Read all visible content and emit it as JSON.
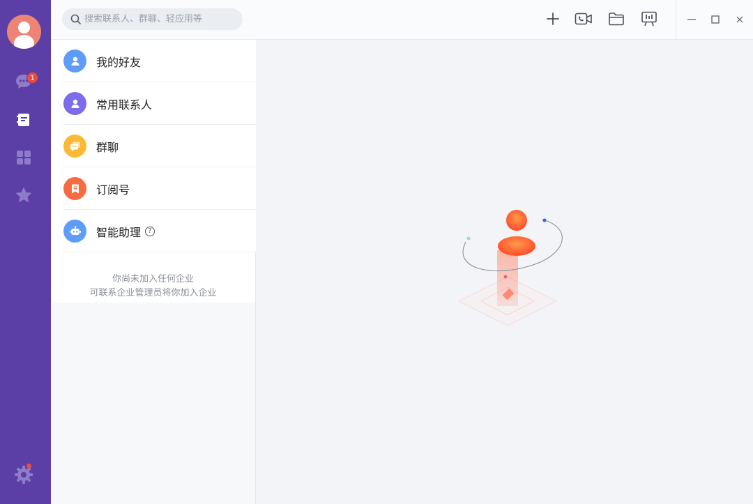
{
  "rail": {
    "avatar_icon": "user-avatar",
    "unread_badge": "1",
    "items": [
      {
        "name": "chat",
        "icon": "chat-bubble-icon"
      },
      {
        "name": "contacts",
        "icon": "contacts-book-icon"
      },
      {
        "name": "apps",
        "icon": "apps-grid-icon"
      },
      {
        "name": "favorites",
        "icon": "star-icon"
      }
    ],
    "settings_icon": "gear-icon",
    "background": "#5b3fa6"
  },
  "search": {
    "placeholder": "搜索联系人、群聊、轻应用等",
    "value": ""
  },
  "toolbar": {
    "tools": [
      "plus-icon",
      "video-call-icon",
      "folder-icon",
      "presentation-icon"
    ],
    "window": [
      "minimize-icon",
      "maximize-icon",
      "close-icon"
    ]
  },
  "contacts": {
    "items": [
      {
        "label": "我的好友",
        "icon": "person-icon",
        "color": "#5d9df7"
      },
      {
        "label": "常用联系人",
        "icon": "person-icon",
        "color": "#7a6cea"
      },
      {
        "label": "群聊",
        "icon": "group-chat-icon",
        "color": "#fcb935"
      },
      {
        "label": "订阅号",
        "icon": "bookmark-icon",
        "color": "#f66b3f"
      },
      {
        "label": "智能助理",
        "icon": "robot-icon",
        "color": "#5d9df7",
        "help": "?"
      }
    ],
    "note_line1": "你尚未加入任何企业",
    "note_line2": "可联系企业管理员将你加入企业"
  }
}
